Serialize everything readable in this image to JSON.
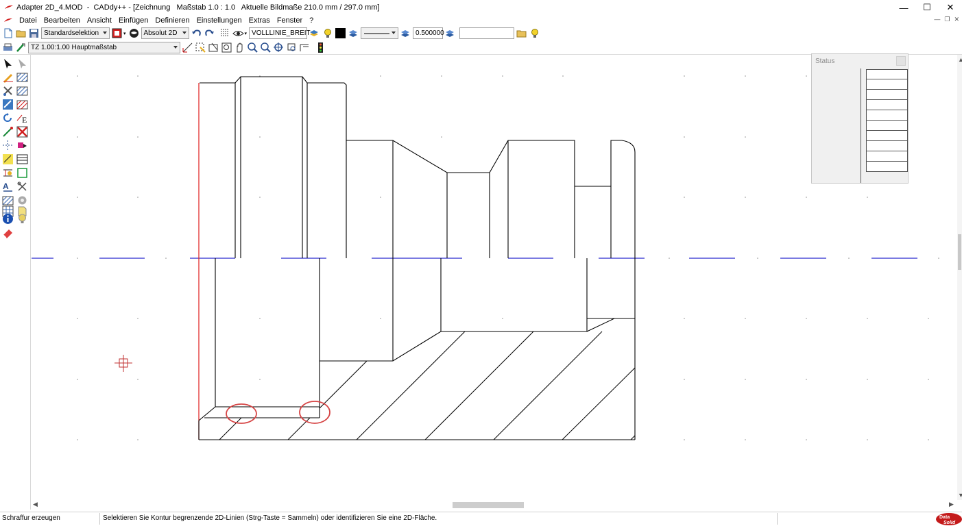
{
  "window": {
    "title": "Adapter 2D_4.MOD  -  CADdy++ - [Zeichnung   Maßstab 1.0 : 1.0   Aktuelle Bildmaße 210.0 mm / 297.0 mm]",
    "minimize": "—",
    "maximize": "☐",
    "close": "✕"
  },
  "menu": {
    "items": [
      "Datei",
      "Bearbeiten",
      "Ansicht",
      "Einfügen",
      "Definieren",
      "Einstellungen",
      "Extras",
      "Fenster",
      "?"
    ]
  },
  "toolbar1": {
    "selection_mode": "Standardselektion",
    "coord_mode": "Absolut 2D",
    "line_style": "VOLLLINIE_BREIT",
    "line_width": "0.500000",
    "search_value": ""
  },
  "toolbar2": {
    "view_scale": "TZ 1.00:1.00 Hauptmaßstab"
  },
  "status_panel": {
    "title": "Status",
    "rows": [
      "",
      "",
      "",
      "",
      "",
      "",
      "",
      "",
      "",
      ""
    ]
  },
  "statusbar": {
    "command": "Schraffur erzeugen",
    "message": "Selektieren Sie Kontur begrenzende 2D-Linien (Strg-Taste = Sammeln) oder identifizieren Sie eine 2D-Fläche.",
    "logo_text": "Data Solid"
  },
  "colors": {
    "drawing_line": "#000000",
    "center_line": "#2b2bcf",
    "red_line": "#e02020",
    "highlight": "#d64545",
    "grid_dot": "#909090",
    "cursor": "#c03030"
  }
}
